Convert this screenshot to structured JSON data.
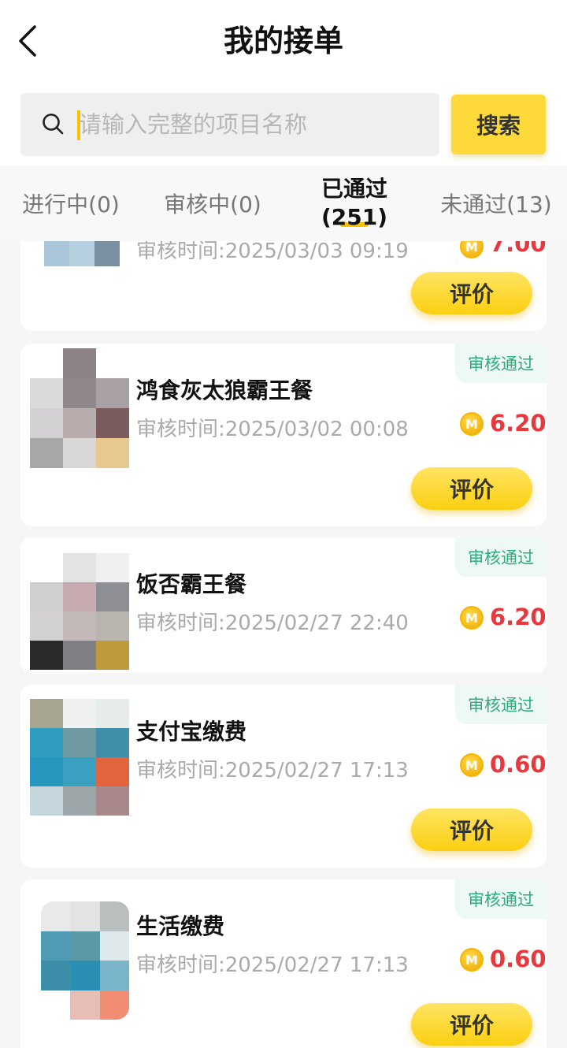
{
  "header": {
    "back_icon": "chevron-left-icon",
    "title": "我的接单"
  },
  "search": {
    "icon": "search-icon",
    "placeholder": "请输入完整的项目名称",
    "button_label": "搜索"
  },
  "tabs": [
    {
      "label": "进行中(0)",
      "active": false
    },
    {
      "label": "审核中(0)",
      "active": false
    },
    {
      "label_line1": "已通过",
      "label_line2": "(251)",
      "active": true
    },
    {
      "label": "未通过(13)",
      "active": false
    }
  ],
  "orders": [
    {
      "name": "",
      "time": "审核时间:2025/03/03 09:19",
      "price": "7.00",
      "button": "评价"
    },
    {
      "badge": "审核通过",
      "name": "鸿食灰太狼霸王餐",
      "time": "审核时间:2025/03/02 00:08",
      "price": "6.20",
      "button": "评价"
    },
    {
      "badge": "审核通过",
      "name": "饭否霸王餐",
      "time": "审核时间:2025/02/27 22:40",
      "price": "6.20"
    },
    {
      "badge": "审核通过",
      "name": "支付宝缴费",
      "time": "审核时间:2025/02/27 17:13",
      "price": "0.60",
      "button": "评价"
    },
    {
      "badge": "审核通过",
      "name": "生活缴费",
      "time": "审核时间:2025/02/27 17:13",
      "price": "0.60",
      "button": "评价"
    }
  ],
  "coin_symbol": "M",
  "colors": {
    "accent": "#fdd93a",
    "price": "#e8383d",
    "badge_text": "#2faa7a",
    "badge_bg": "#eef8f4"
  }
}
